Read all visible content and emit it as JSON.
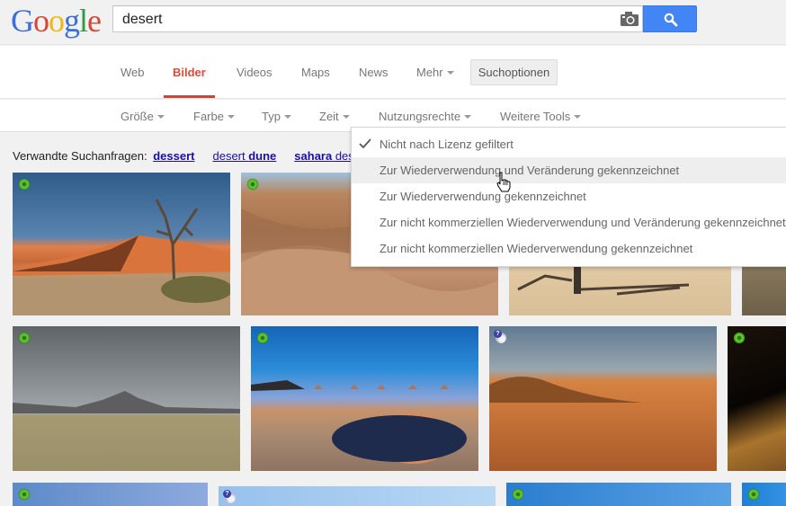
{
  "header": {
    "logo": [
      "G",
      "o",
      "o",
      "g",
      "l",
      "e"
    ],
    "search_value": "desert",
    "search_placeholder": "",
    "camera_icon": "camera-icon",
    "search_icon": "search-icon"
  },
  "nav": {
    "tabs": [
      {
        "label": "Web"
      },
      {
        "label": "Bilder",
        "active": true
      },
      {
        "label": "Videos"
      },
      {
        "label": "Maps"
      },
      {
        "label": "News"
      },
      {
        "label": "Mehr"
      }
    ],
    "search_tools_label": "Suchoptionen"
  },
  "tools": {
    "items": [
      {
        "label": "Größe"
      },
      {
        "label": "Farbe"
      },
      {
        "label": "Typ"
      },
      {
        "label": "Zeit"
      },
      {
        "label": "Nutzungsrechte"
      },
      {
        "label": "Weitere Tools"
      }
    ]
  },
  "related": {
    "label": "Verwandte Suchanfragen:",
    "items": [
      {
        "bold": "dessert",
        "plain": ""
      },
      {
        "plain": "desert ",
        "bold": "dune"
      },
      {
        "bold": "sahara",
        "plain": " des"
      }
    ]
  },
  "license_menu": {
    "items": [
      {
        "label": "Nicht nach Lizenz gefiltert",
        "checked": true
      },
      {
        "label": "Zur Wiederverwendung und Veränderung gekennzeichnet",
        "hovered": true
      },
      {
        "label": "Zur Wiederverwendung gekennzeichnet"
      },
      {
        "label": "Zur nicht kommerziellen Wiederverwendung und Veränderung gekennzeichnet"
      },
      {
        "label": "Zur nicht kommerziellen Wiederverwendung gekennzeichnet"
      }
    ]
  },
  "images": [
    {
      "subject": "dead tree and red dune",
      "badge": "green"
    },
    {
      "subject": "sand dunes",
      "badge": "green"
    },
    {
      "subject": "dead tree on sand",
      "badge": "none"
    },
    {
      "subject": "desert scrub",
      "badge": "none"
    },
    {
      "subject": "salt flat with mountain",
      "badge": "green"
    },
    {
      "subject": "sand cone and crater",
      "badge": "green"
    },
    {
      "subject": "orange dunes",
      "badge": "unknown"
    },
    {
      "subject": "dune ripples at night",
      "badge": "green"
    },
    {
      "subject": "blue sky",
      "badge": "green"
    },
    {
      "subject": "light blue sky",
      "badge": "unknown"
    },
    {
      "subject": "blue sky landscape",
      "badge": "green"
    },
    {
      "subject": "sky",
      "badge": "green"
    }
  ]
}
